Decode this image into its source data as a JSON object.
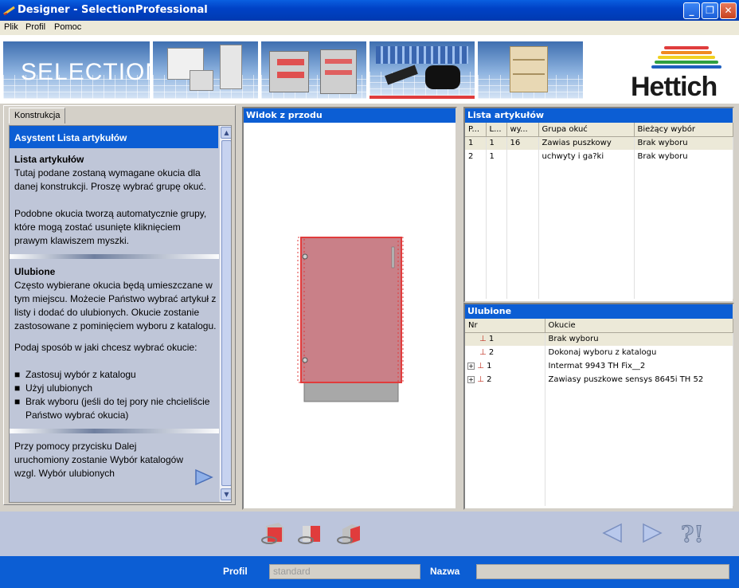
{
  "window": {
    "title": "Designer - SelectionProfessional"
  },
  "menu": [
    "Plik",
    "Profil",
    "Pomoc"
  ],
  "banner": {
    "selection_text": "SELECTION",
    "brand": "Hettich"
  },
  "left": {
    "tab": "Konstrukcja",
    "header": "Asystent Lista artykułów",
    "s1_title": "Lista artykułów",
    "s1_p1": "Tutaj podane zostaną wymagane okucia dla danej konstrukcji. Proszę wybrać grupę okuć.",
    "s1_p2": "Podobne okucia tworzą automatycznie grupy, które mogą zostać usunięte kliknięciem prawym klawiszem myszki.",
    "s2_title": "Ulubione",
    "s2_p1": "Często wybierane okucia będą umieszczane w tym miejscu. Możecie Państwo wybrać artykuł z listy i dodać do ulubionych. Okucie zostanie zastosowane z pominięciem wyboru z katalogu.",
    "s2_p2": "Podaj sposób w jaki chcesz wybrać okucie:",
    "bullets": [
      "Zastosuj wybór z katalogu",
      "Użyj ulubionych",
      "Brak wyboru (jeśli do tej pory nie chcieliście Państwo wybrać okucia)"
    ],
    "s3_p1": "Przy pomocy przycisku Dalej uruchomiony zostanie Wybór katalogów wzgl. Wybór ulubionych"
  },
  "center": {
    "title": "Widok z przodu"
  },
  "articles": {
    "title": "Lista artykułów",
    "headers": [
      "P...",
      "L...",
      "wy...",
      "Grupa okuć",
      "Bieżący wybór"
    ],
    "rows": [
      [
        "1",
        "1",
        "16",
        "Zawias puszkowy",
        "Brak wyboru"
      ],
      [
        "2",
        "1",
        "",
        "uchwyty i ga?ki",
        "Brak wyboru"
      ]
    ]
  },
  "favorites": {
    "title": "Ulubione",
    "headers": [
      "Nr",
      "Okucie"
    ],
    "rows": [
      {
        "nr": "1",
        "name": "Brak wyboru",
        "expand": false
      },
      {
        "nr": "2",
        "name": "Dokonaj wyboru z katalogu",
        "expand": false
      },
      {
        "nr": "1",
        "name": "Intermat 9943 TH Fix__2",
        "expand": true
      },
      {
        "nr": "2",
        "name": "Zawiasy puszkowe sensys 8645i TH 52",
        "expand": true
      }
    ]
  },
  "status": {
    "profil_label": "Profil",
    "profil_value": "standard",
    "nazwa_label": "Nazwa",
    "nazwa_value": ""
  },
  "colors": {
    "accent": "#0c5ed4",
    "cabinet": "#c98088",
    "cabinet_edge": "#e03c3c"
  }
}
